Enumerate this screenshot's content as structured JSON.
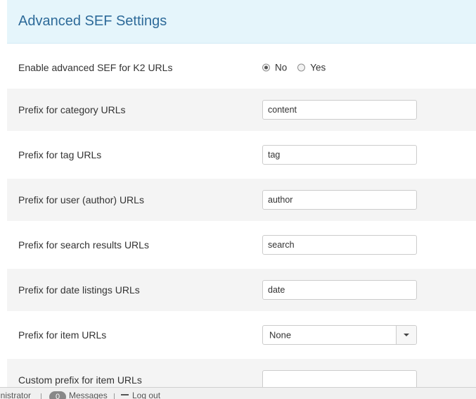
{
  "section": {
    "title": "Advanced SEF Settings"
  },
  "fields": {
    "enable_sef": {
      "label": "Enable advanced SEF for K2 URLs",
      "options": [
        "No",
        "Yes"
      ],
      "selected": "No"
    },
    "category_prefix": {
      "label": "Prefix for category URLs",
      "value": "content"
    },
    "tag_prefix": {
      "label": "Prefix for tag URLs",
      "value": "tag"
    },
    "user_prefix": {
      "label": "Prefix for user (author) URLs",
      "value": "author"
    },
    "search_prefix": {
      "label": "Prefix for search results URLs",
      "value": "search"
    },
    "date_prefix": {
      "label": "Prefix for date listings URLs",
      "value": "date"
    },
    "item_prefix": {
      "label": "Prefix for item URLs",
      "selected": "None"
    },
    "custom_item_prefix": {
      "label": "Custom prefix for item URLs",
      "value": ""
    }
  },
  "status_bar": {
    "user": "inistrator",
    "messages_count": "0",
    "messages_label": "Messages",
    "logout_label": "Log out"
  }
}
